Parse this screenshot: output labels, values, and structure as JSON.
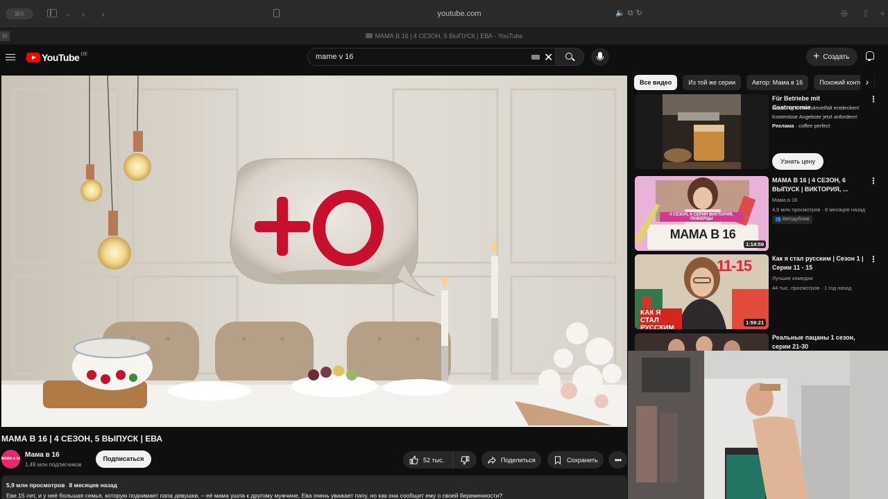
{
  "browser": {
    "pill_label": "⌘K",
    "address": "youtube.com",
    "tab_title": "МАМА В 16 | 4 СЕЗОН, 5 ВЫПУСК | ЕВА - YouTube",
    "favicon_letter": "M"
  },
  "header": {
    "logo_text": "YouTube",
    "region": "DE",
    "search_value": "mame v 16",
    "create_label": "Создать"
  },
  "video": {
    "title": "МАМА В 16 | 4 СЕЗОН, 5 ВЫПУСК | ЕВА",
    "channel_name": "Мама в 16",
    "channel_avatar_text": "МАМА в 16",
    "subscribers": "1,49 млн подписчиков",
    "subscribe_label": "Подписаться",
    "likes": "52 тыс.",
    "share_label": "Поделиться",
    "save_label": "Сохранить",
    "views": "5,9 млн просмотров",
    "age": "8 месяцев назад",
    "description": "Еве 15 лет, и у неё большая семья, которую поднимает папа девушки, – её мама ушла к другому мужчине. Ева очень уважает папу, но как она сообщит ему о своей беременности?"
  },
  "chips": [
    {
      "label": "Все видео"
    },
    {
      "label": "Из той же серии"
    },
    {
      "label": "Автор: Мама в 16"
    },
    {
      "label": "Похожий контент"
    }
  ],
  "recommendations": {
    "ad": {
      "title": "Für Betriebe mit Gastronomie",
      "line1": "Beratung & Produktvielfalt entdecken!",
      "line2": "Kostenlose Angebote jetzt anfordern!",
      "ad_label": "Реклама",
      "advertiser": "· coffee perfect",
      "cta": "Узнать цену"
    },
    "items": [
      {
        "title": "МАМА В 16 | 4 СЕЗОН, 6 ВЫПУСК | ВИКТОРИЯ, ...",
        "channel": "Мама в 16",
        "meta": "4,6 млн просмотров · 8 месяцев назад",
        "badge": "Автодубляж",
        "duration": "1:14:59",
        "thumb_caption": "4 СЕЗОН, 6 СЕРИЯ ВИКТОРИЯ, ЛЮБЕРЦЫ",
        "thumb_logo": "МАМА В 16"
      },
      {
        "title": "Как я стал русским | Сезон 1 | Серии 11 - 15",
        "channel": "Лучшие комедии",
        "meta": "44 тыс. просмотров · 1 год назад",
        "duration": "1:59:21",
        "thumb_number": "11-15",
        "thumb_text": "КАК Я СТАЛ РУССКИМ"
      },
      {
        "title": "Реальные пацаны 1 сезон, серии 21-30"
      }
    ]
  }
}
